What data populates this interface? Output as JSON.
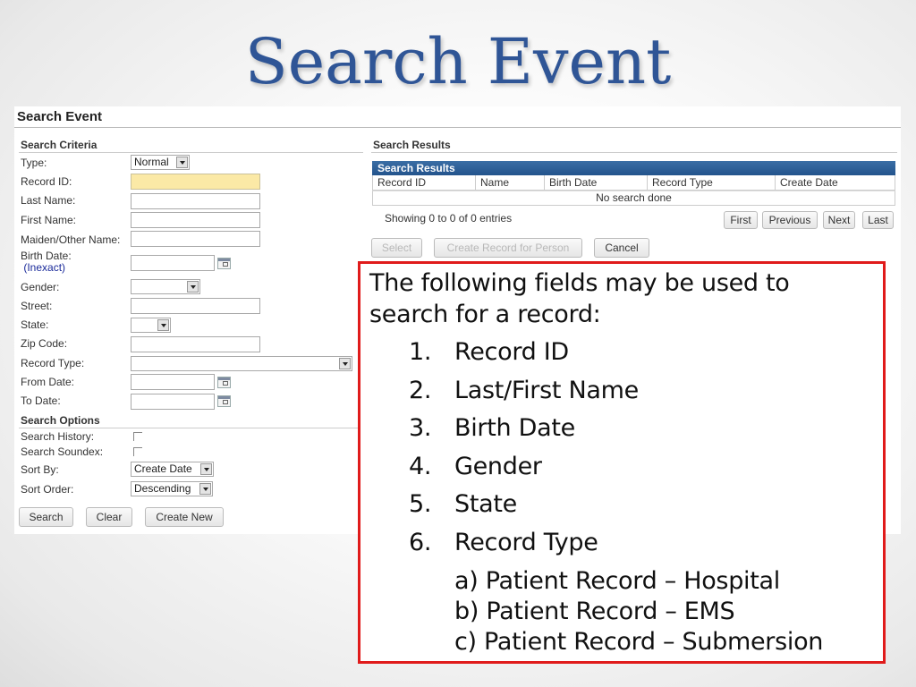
{
  "slide": {
    "title": "Search Event"
  },
  "app": {
    "page_header": "Search Event",
    "criteria": {
      "title": "Search Criteria",
      "type_label": "Type:",
      "type_value": "Normal",
      "record_id_label": "Record ID:",
      "record_id_value": "",
      "last_name_label": "Last Name:",
      "last_name_value": "",
      "first_name_label": "First Name:",
      "first_name_value": "",
      "maiden_label": "Maiden/Other Name:",
      "maiden_value": "",
      "birth_date_label": "Birth Date:",
      "birth_date_inexact": "(Inexact)",
      "birth_date_value": "",
      "gender_label": "Gender:",
      "gender_value": "",
      "street_label": "Street:",
      "street_value": "",
      "state_label": "State:",
      "state_value": "",
      "zip_label": "Zip Code:",
      "zip_value": "",
      "record_type_label": "Record Type:",
      "record_type_value": "",
      "from_date_label": "From Date:",
      "from_date_value": "",
      "to_date_label": "To Date:",
      "to_date_value": ""
    },
    "options": {
      "title": "Search Options",
      "history_label": "Search History:",
      "history_checked": false,
      "soundex_label": "Search Soundex:",
      "soundex_checked": false,
      "sort_by_label": "Sort By:",
      "sort_by_value": "Create Date",
      "sort_order_label": "Sort Order:",
      "sort_order_value": "Descending"
    },
    "form_buttons": {
      "search": "Search",
      "clear": "Clear",
      "create_new": "Create New"
    },
    "results": {
      "section_title": "Search Results",
      "grid_title": "Search Results",
      "columns": [
        "Record ID",
        "Name",
        "Birth Date",
        "Record Type",
        "Create Date"
      ],
      "empty_message": "No search done",
      "info": "Showing 0 to 0 of 0 entries",
      "pager": {
        "first": "First",
        "previous": "Previous",
        "next": "Next",
        "last": "Last"
      },
      "actions": {
        "select": "Select",
        "create_record": "Create Record for Person",
        "cancel": "Cancel"
      }
    }
  },
  "callout": {
    "intro_line1": "The following fields may be used to",
    "intro_line2": "search for a record:",
    "items": [
      {
        "num": "1.",
        "text": "Record ID"
      },
      {
        "num": "2.",
        "text": "Last/First Name"
      },
      {
        "num": "3.",
        "text": "Birth Date"
      },
      {
        "num": "4.",
        "text": "Gender"
      },
      {
        "num": "5.",
        "text": "State"
      },
      {
        "num": "6.",
        "text": "Record Type"
      }
    ],
    "subitems": [
      "a) Patient Record – Hospital",
      "b) Patient Record – EMS",
      "c) Patient Record – Submersion"
    ],
    "border_color": "#e01b1b"
  },
  "colors": {
    "title_blue": "#2f5596",
    "grid_header": "#2b5d96",
    "highlight_field": "#fbe9a6"
  }
}
